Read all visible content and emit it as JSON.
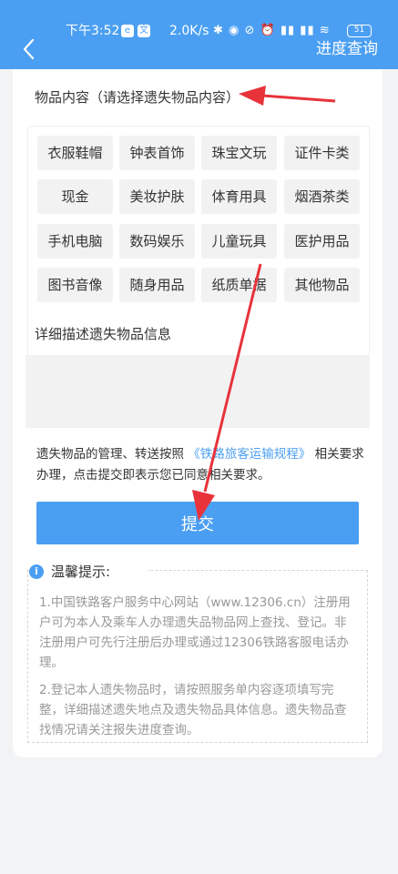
{
  "statusbar": {
    "time": "下午3:52",
    "speed": "2.0K/s",
    "icons": "✱ ◉ ⊘ ⏰ ▮▮ ▮▮ ≋",
    "battery": "51",
    "mini_left": "e",
    "mini_right": "文"
  },
  "header": {
    "progress_query_label": "进度查询"
  },
  "category_section": {
    "label": "物品内容（请选择遗失物品内容）",
    "chips": [
      "衣服鞋帽",
      "钟表首饰",
      "珠宝文玩",
      "证件卡类",
      "现金",
      "美妆护肤",
      "体育用具",
      "烟酒茶类",
      "手机电脑",
      "数码娱乐",
      "儿童玩具",
      "医护用品",
      "图书音像",
      "随身用品",
      "纸质单据",
      "其他物品"
    ]
  },
  "detail_section": {
    "label": "详细描述遗失物品信息",
    "placeholder": ""
  },
  "notice": {
    "prefix": "遗失物品的管理、转送按照",
    "link": "《铁路旅客运输规程》",
    "suffix": "相关要求办理，点击提交即表示您已同意相关要求。"
  },
  "submit_label": "提交",
  "tips": {
    "title": "温馨提示:",
    "items": [
      "1.中国铁路客户服务中心网站（www.12306.cn）注册用户可为本人及乘车人办理遗失品物品网上查找、登记。非注册用户可先行注册后办理或通过12306铁路客服电话办理。",
      "2.登记本人遗失物品时，请按照服务单内容逐项填写完整，详细描述遗失地点及遗失物品具体信息。遗失物品查找情况请关注报失进度查询。"
    ]
  },
  "colors": {
    "accent": "#4b9ff2",
    "annotation": "#e8333b"
  }
}
